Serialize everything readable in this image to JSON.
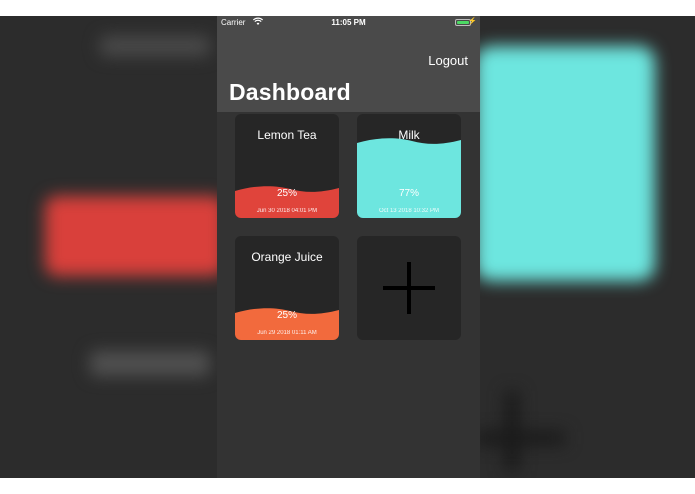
{
  "status_bar": {
    "carrier": "Carrier",
    "time": "11:05 PM",
    "wifi_icon": "wifi-icon",
    "battery_icon": "battery-icon"
  },
  "nav": {
    "logout_label": "Logout",
    "title": "Dashboard"
  },
  "drinks": [
    {
      "name": "Lemon Tea",
      "percent": "25%",
      "level": 0.25,
      "date": "Jun 30 2018 04:01 PM",
      "color": "#e0443b"
    },
    {
      "name": "Milk",
      "percent": "77%",
      "level": 0.77,
      "date": "Oct 13 2018 10:32 PM",
      "color": "#6de6df"
    },
    {
      "name": "Orange Juice",
      "percent": "25%",
      "level": 0.25,
      "date": "Jun 29 2018 01:11 AM",
      "color": "#f26a3d"
    }
  ],
  "add_card": {
    "icon": "plus-icon"
  },
  "colors": {
    "background": "#333333",
    "navbar": "#4a4a4a",
    "card": "#262626"
  }
}
